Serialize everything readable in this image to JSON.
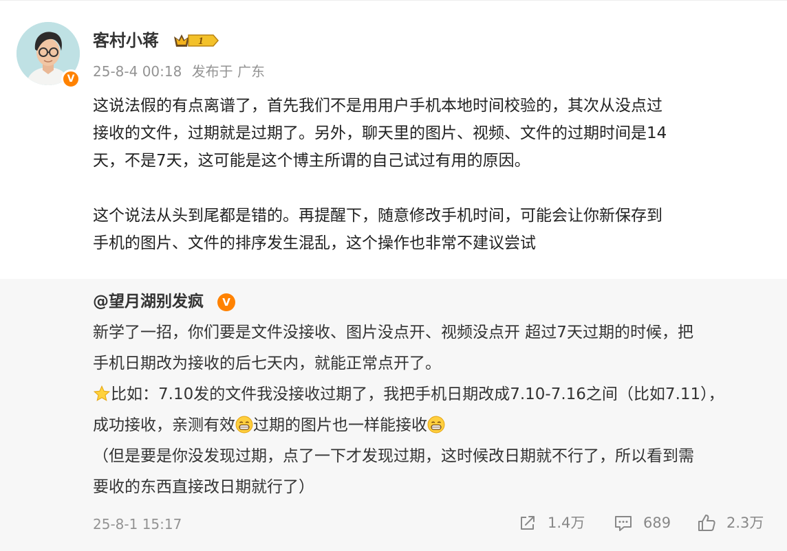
{
  "author": {
    "name": "客村小蒋",
    "level": "1",
    "verified_icon": "v-verified-icon"
  },
  "post": {
    "time": "25-8-4 00:18",
    "location": "发布于 广东",
    "paragraphs": [
      "这说法假的有点离谱了，首先我们不是用用户手机本地时间校验的，其次从没点过\n接收的文件，过期就是过期了。另外，聊天里的图片、视频、文件的过期时间是14\n天，不是7天，这可能是这个博主所谓的自己试过有用的原因。",
      "这个说法从头到尾都是错的。再提醒下，随意修改手机时间，可能会让你新保存到\n手机的图片、文件的排序发生混乱，这个操作也非常不建议尝试"
    ]
  },
  "quoted": {
    "user": "@望月湖别发疯",
    "line1": "新学了一招，你们要是文件没接收、图片没点开、视频没点开 超过7天过期的时候，把\n手机日期改为接收的后七天内，就能正常点开了。",
    "line2_a": "比如：7.10发的文件我没接收过期了，我把手机日期改成7.10-7.16之间（比如7.11），\n成功接收，亲测有效",
    "line2_b": "过期的图片也一样能接收",
    "line3": "（但是要是你没发现过期，点了一下才发现过期，这时候改日期就不行了，所以看到需\n要收的东西直接改日期就行了）",
    "date": "25-8-1 15:17",
    "stats": {
      "reposts": "1.4万",
      "comments": "689",
      "likes": "2.3万"
    }
  },
  "colors": {
    "accent_orange": "#ff8200",
    "meta_gray": "#939393",
    "quote_bg": "#f7f7f7"
  }
}
